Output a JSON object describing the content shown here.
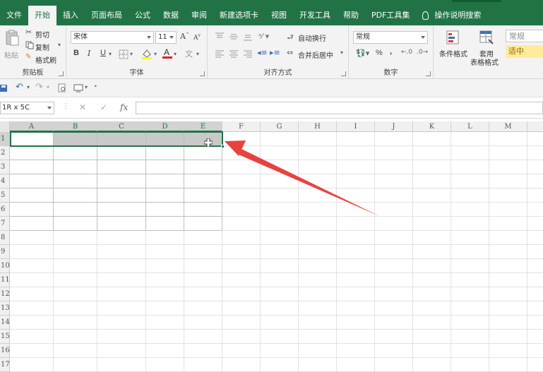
{
  "tabs": [
    {
      "label": "文件",
      "active": false
    },
    {
      "label": "开始",
      "active": true
    },
    {
      "label": "插入",
      "active": false
    },
    {
      "label": "页面布局",
      "active": false
    },
    {
      "label": "公式",
      "active": false
    },
    {
      "label": "数据",
      "active": false
    },
    {
      "label": "审阅",
      "active": false
    },
    {
      "label": "新建选项卡",
      "active": false
    },
    {
      "label": "视图",
      "active": false
    },
    {
      "label": "开发工具",
      "active": false
    },
    {
      "label": "帮助",
      "active": false
    },
    {
      "label": "PDF工具集",
      "active": false
    }
  ],
  "search_tab": "操作说明搜索",
  "clipboard": {
    "paste": "粘贴",
    "cut": "剪切",
    "copy": "复制",
    "format_painter": "格式刷",
    "group_label": "剪贴板"
  },
  "font": {
    "font_name": "宋体",
    "font_size": "11",
    "bold": "B",
    "italic": "I",
    "underline": "U",
    "group_label": "字体"
  },
  "alignment": {
    "wrap_text": "自动换行",
    "merge_center": "合并后居中",
    "group_label": "对齐方式"
  },
  "number": {
    "format": "常规",
    "percent": "%",
    "comma": ",",
    "group_label": "数字"
  },
  "styles": {
    "conditional_format": "条件格式",
    "table_format_line1": "套用",
    "table_format_line2": "表格格式",
    "style_normal": "常规",
    "style_neutral": "适中"
  },
  "formula_bar": {
    "name_box": "1R x 5C",
    "fx": "fx",
    "cancel": "✕",
    "confirm": "✓"
  },
  "columns": [
    "A",
    "B",
    "C",
    "D",
    "E",
    "F",
    "G",
    "H",
    "I",
    "J",
    "K",
    "L",
    "M"
  ],
  "rows": [
    "1",
    "2",
    "3",
    "4",
    "5",
    "6",
    "7",
    "8",
    "9",
    "10",
    "11",
    "12",
    "13",
    "14",
    "15",
    "16",
    "17"
  ],
  "colors": {
    "accent": "#217346",
    "arrow": "#e8423f",
    "neutral_style_bg": "#ffeb9c",
    "neutral_style_text": "#9c6500"
  }
}
